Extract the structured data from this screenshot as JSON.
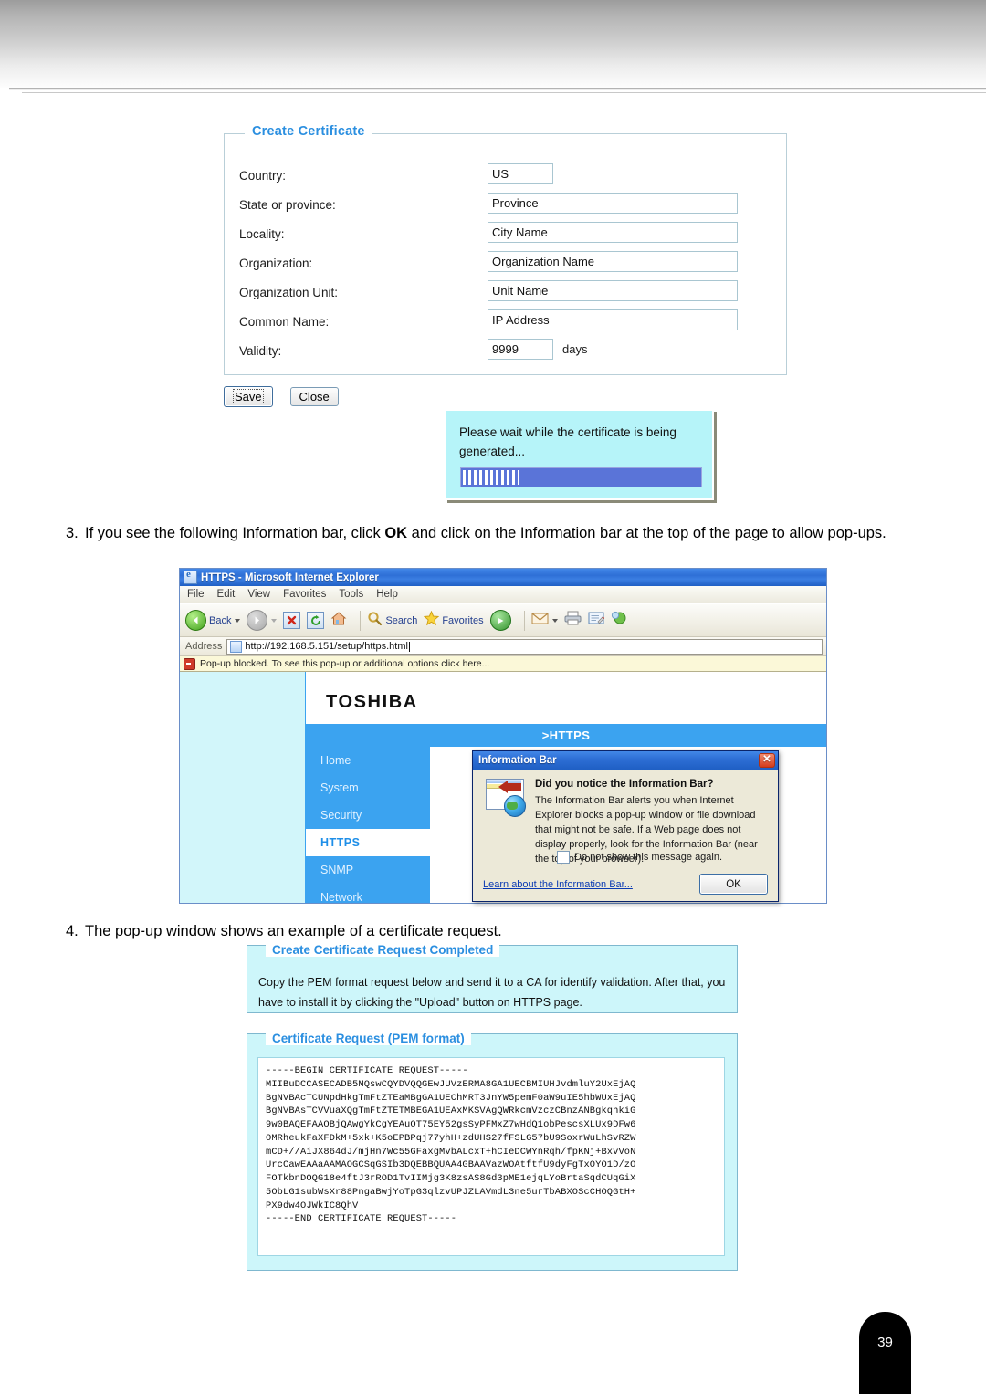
{
  "document": {
    "page_number": "39"
  },
  "cert_form": {
    "legend": "Create Certificate",
    "fields": [
      {
        "label": "Country:",
        "value": "US",
        "size": "small"
      },
      {
        "label": "State or province:",
        "value": "Province",
        "size": "wide"
      },
      {
        "label": "Locality:",
        "value": "City Name",
        "size": "wide"
      },
      {
        "label": "Organization:",
        "value": "Organization Name",
        "size": "wide"
      },
      {
        "label": "Organization Unit:",
        "value": "Unit Name",
        "size": "wide"
      },
      {
        "label": "Common Name:",
        "value": "IP Address",
        "size": "wide"
      },
      {
        "label": "Validity:",
        "value": "9999",
        "size": "small",
        "unit": "days"
      }
    ],
    "save_label": "Save",
    "close_label": "Close"
  },
  "wait_dialog": {
    "message": "Please wait while the certificate is being generated..."
  },
  "steps": {
    "step3_num": "3.",
    "step3_before": "If you see the following Information bar, click ",
    "step3_bold": "OK",
    "step3_after": " and click on the Information bar at the top of the page to allow pop-ups.",
    "step4_num": "4.",
    "step4_text": "The pop-up window shows an example of a certificate request."
  },
  "browser": {
    "title": "HTTPS - Microsoft Internet Explorer",
    "menu": [
      "File",
      "Edit",
      "View",
      "Favorites",
      "Tools",
      "Help"
    ],
    "toolbar": {
      "back_label": "Back",
      "search_label": "Search",
      "favorites_label": "Favorites"
    },
    "address_label": "Address",
    "address_value": "http://192.168.5.151/setup/https.html",
    "popup_bar_text": "Pop-up blocked. To see this pop-up or additional options click here...",
    "site": {
      "logo": "TOSHIBA",
      "breadcrumb": ">HTTPS",
      "nav": [
        {
          "label": "Home",
          "active": false
        },
        {
          "label": "System",
          "active": false
        },
        {
          "label": "Security",
          "active": false
        },
        {
          "label": "HTTPS",
          "active": true
        },
        {
          "label": "SNMP",
          "active": false
        },
        {
          "label": "Network",
          "active": false
        }
      ]
    }
  },
  "info_dialog": {
    "title": "Information Bar",
    "heading": "Did you notice the Information Bar?",
    "body": "The Information Bar alerts you when Internet Explorer blocks a pop-up window or file download that might not be safe. If a Web page does not display properly, look for the Information Bar (near the top of your browser).",
    "checkbox_label": "Do not show this message again.",
    "link_label": "Learn about the Information Bar...",
    "ok_label": "OK"
  },
  "cert_request": {
    "completed_legend": "Create Certificate Request Completed",
    "completed_text": "Copy the PEM format request below and send it to a CA for identify validation. After that, you have to install it by clicking the \"Upload\" button on HTTPS page.",
    "pem_legend": "Certificate Request (PEM format)",
    "pem_body": "-----BEGIN CERTIFICATE REQUEST-----\nMIIBuDCCASECADB5MQswCQYDVQQGEwJUVzERMA8GA1UECBMIUHJvdmluY2UxEjAQ\nBgNVBAcTCUNpdHkgTmFtZTEaMBgGA1UEChMRT3JnYW5pemF0aW9uIE5hbWUxEjAQ\nBgNVBAsTCVVuaXQgTmFtZTETMBEGA1UEAxMKSVAgQWRkcmVzczCBnzANBgkqhkiG\n9w0BAQEFAAOBjQAwgYkCgYEAuOT75EY52gsSyPFMxZ7wHdQ1obPescsXLUx9DFw6\nOMRheukFaXFDkM+5xk+K5oEPBPqj77yhH+zdUHS27fFSLG57bU9SoxrWuLhSvRZW\nmCD+//AiJX864dJ/mjHn7Wc55GFaxgMvbALcxT+hCIeDCWYnRqh/fpKNj+BxvVoN\nUrcCawEAAaAAMAOGCSqGSIb3DQEBBQUAA4GBAAVazWOAtftfU9dyFgTxOYO1D/zO\nFOTkbnDOQG18e4ftJ3rROD1TvIIMjg3K8zsAS8Gd3pME1ejqLYoBrtaSqdCUqGiX\n5ObLG1subWsXr88PngaBwjYoTpG3qlzvUPJZLAVmdL3ne5urTbABXOScCHOQGtH+\nPX9dw4OJWkIC8QhV\n-----END CERTIFICATE REQUEST-----"
  }
}
